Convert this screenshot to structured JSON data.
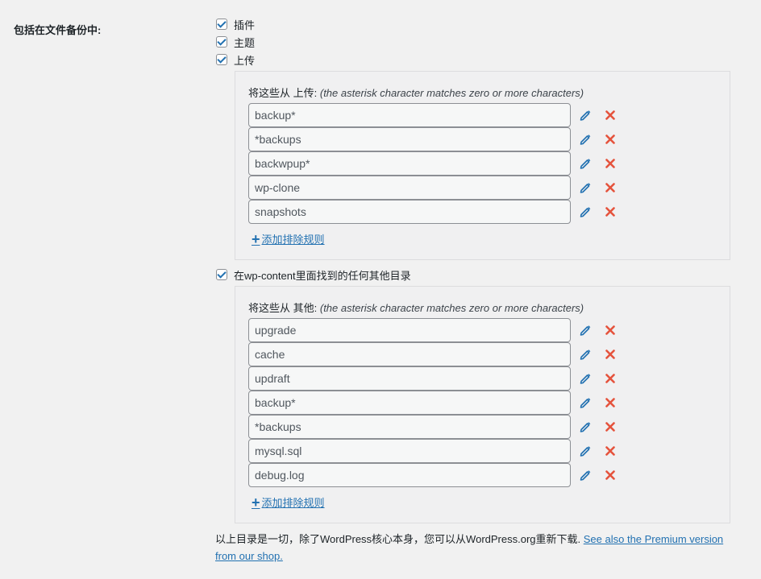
{
  "section_label": "包括在文件备份中:",
  "checkboxes": {
    "plugins": {
      "label": "插件",
      "checked": true
    },
    "themes": {
      "label": "主题",
      "checked": true
    },
    "uploads": {
      "label": "上传",
      "checked": true
    },
    "others": {
      "label": "在wp-content里面找到的任何其他目录",
      "checked": true
    }
  },
  "uploads_panel": {
    "heading_prefix": "将这些从 上传:",
    "heading_hint": "(the asterisk character matches zero or more characters)",
    "rules": [
      "backup*",
      "*backups",
      "backwpup*",
      "wp-clone",
      "snapshots"
    ],
    "add_label": "添加排除规则"
  },
  "others_panel": {
    "heading_prefix": "将这些从 其他:",
    "heading_hint": "(the asterisk character matches zero or more characters)",
    "rules": [
      "upgrade",
      "cache",
      "updraft",
      "backup*",
      "*backups",
      "mysql.sql",
      "debug.log"
    ],
    "add_label": "添加排除规则"
  },
  "footer": {
    "text": "以上目录是一切，除了WordPress核心本身，您可以从WordPress.org重新下载.",
    "link_text": "See also the Premium version from our shop."
  },
  "colors": {
    "accent": "#2271b1",
    "delete": "#e5533d"
  },
  "icons": {
    "edit": "pencil-icon",
    "delete": "close-icon",
    "add": "plus-icon"
  }
}
